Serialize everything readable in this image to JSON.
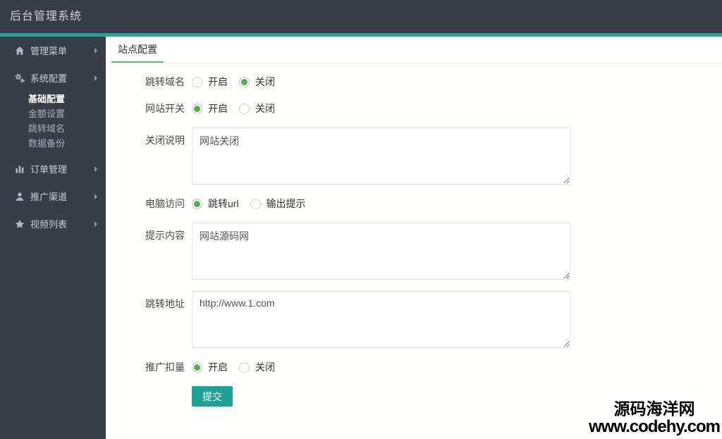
{
  "colors": {
    "header_bg": "#383d47",
    "accent_teal_line": "#28a197",
    "accent_green": "#5fb878",
    "submit_button_bg": "#1da295"
  },
  "header": {
    "title": "后台管理系统"
  },
  "sidebar": {
    "items": [
      {
        "name": "管理菜单",
        "icon": "home-icon",
        "has_children": true,
        "expanded": false
      },
      {
        "name": "系统配置",
        "icon": "cogs-icon",
        "has_children": true,
        "expanded": true,
        "children": [
          {
            "name": "基础配置",
            "active": true
          },
          {
            "name": "金额设置",
            "active": false
          },
          {
            "name": "跳转域名",
            "active": false
          },
          {
            "name": "数据备份",
            "active": false
          }
        ]
      },
      {
        "name": "订单管理",
        "icon": "bar-chart-icon",
        "has_children": true,
        "expanded": false
      },
      {
        "name": "推广渠道",
        "icon": "user-icon",
        "has_children": true,
        "expanded": false
      },
      {
        "name": "视频列表",
        "icon": "star-icon",
        "has_children": true,
        "expanded": false
      }
    ]
  },
  "main": {
    "tab": {
      "label": "站点配置",
      "active": true
    },
    "form": {
      "rows": [
        {
          "label": "跳转域名",
          "type": "radio",
          "options": [
            {
              "label": "开启",
              "checked": false
            },
            {
              "label": "关闭",
              "checked": true
            }
          ]
        },
        {
          "label": "网站开关",
          "type": "radio",
          "options": [
            {
              "label": "开启",
              "checked": true
            },
            {
              "label": "关闭",
              "checked": false
            }
          ]
        },
        {
          "label": "关闭说明",
          "type": "textarea",
          "value": "网站关闭"
        },
        {
          "label": "电脑访问",
          "type": "radio",
          "options": [
            {
              "label": "跳转url",
              "checked": true
            },
            {
              "label": "输出提示",
              "checked": false
            }
          ]
        },
        {
          "label": "提示内容",
          "type": "textarea",
          "value": "网站源码网"
        },
        {
          "label": "跳转地址",
          "type": "textarea",
          "value": "http://www.1.com"
        },
        {
          "label": "推广扣量",
          "type": "radio",
          "options": [
            {
              "label": "开启",
              "checked": true
            },
            {
              "label": "关闭",
              "checked": false
            }
          ]
        }
      ],
      "submit_label": "提交"
    }
  },
  "watermark": {
    "line1": "源码海洋网",
    "line2": "www.codehy.com"
  }
}
